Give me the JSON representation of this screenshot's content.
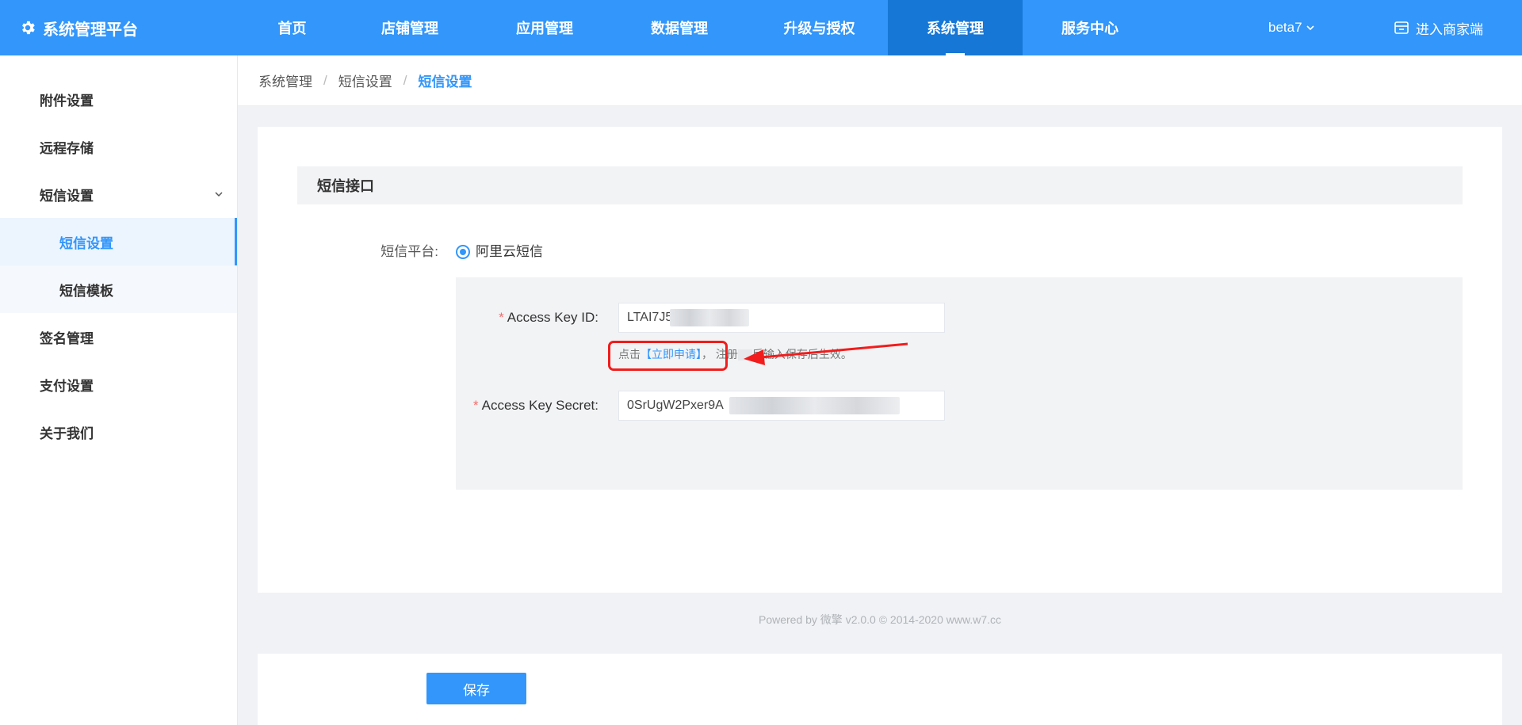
{
  "header": {
    "brand": "系统管理平台",
    "nav": [
      "首页",
      "店铺管理",
      "应用管理",
      "数据管理",
      "升级与授权",
      "系统管理",
      "服务中心"
    ],
    "active_nav": "系统管理",
    "account": "beta7",
    "merchant_link": "进入商家端"
  },
  "sidebar": {
    "items": [
      {
        "label": "附件设置",
        "kind": "top"
      },
      {
        "label": "远程存储",
        "kind": "top"
      },
      {
        "label": "短信设置",
        "kind": "group-open"
      },
      {
        "label": "短信设置",
        "kind": "sub-active"
      },
      {
        "label": "短信模板",
        "kind": "sub"
      },
      {
        "label": "签名管理",
        "kind": "top"
      },
      {
        "label": "支付设置",
        "kind": "top"
      },
      {
        "label": "关于我们",
        "kind": "top"
      }
    ]
  },
  "breadcrumb": [
    "系统管理",
    "短信设置",
    "短信设置"
  ],
  "form": {
    "section_title": "短信接口",
    "platform_label": "短信平台:",
    "platform_option": "阿里云短信",
    "key_id_label": "Access Key ID:",
    "key_id_value": "LTAI7J5S",
    "hint_prefix": "点击",
    "hint_link": "【立即申请】",
    "hint_comma": "，",
    "hint_text_1": "注册",
    "hint_text_2": "后输入保存后生效。",
    "key_secret_label": "Access Key Secret:",
    "key_secret_value": "0SrUgW2Pxer9A"
  },
  "footer": "Powered by 微擎 v2.0.0 © 2014-2020 www.w7.cc",
  "save_label": "保存",
  "colors": {
    "primary": "#3296fa",
    "active_nav_bg": "#1677d6",
    "required": "#f56c6c",
    "annotation": "#f21c1c"
  },
  "icons": {
    "brand": "gear-icon",
    "account_dropdown": "chevron-down-icon",
    "merchant": "store-icon",
    "submenu": "chevron-down-icon"
  }
}
